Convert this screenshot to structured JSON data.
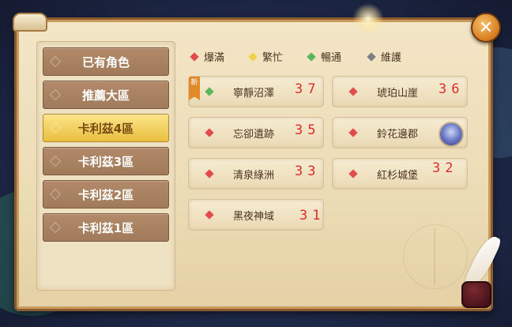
{
  "colors": {
    "bao_man": "#e24b4b",
    "fan_mang": "#f2d24a",
    "chang_tong": "#5bb65b",
    "wei_hu": "#7a7f86"
  },
  "nav": {
    "items": [
      {
        "label": "已有角色"
      },
      {
        "label": "推薦大區"
      },
      {
        "label": "卡利茲4區"
      },
      {
        "label": "卡利茲3區"
      },
      {
        "label": "卡利茲2區"
      },
      {
        "label": "卡利茲1區"
      }
    ],
    "active_index": 2
  },
  "legend": {
    "bao_man": "爆滿",
    "fan_mang": "繁忙",
    "chang_tong": "暢通",
    "wei_hu": "維護"
  },
  "servers": [
    {
      "name": "寧靜沼澤",
      "number": "37",
      "tag": "新"
    },
    {
      "name": "琥珀山崖",
      "number": "36"
    },
    {
      "name": "忘卻遺跡",
      "number": "35"
    },
    {
      "name": "鈴花邊郡",
      "number": ""
    },
    {
      "name": "清泉綠洲",
      "number": "33"
    },
    {
      "name": "紅杉城堡",
      "number": "32"
    },
    {
      "name": "黑夜神域",
      "number": "31"
    }
  ],
  "close_icon": "✕"
}
